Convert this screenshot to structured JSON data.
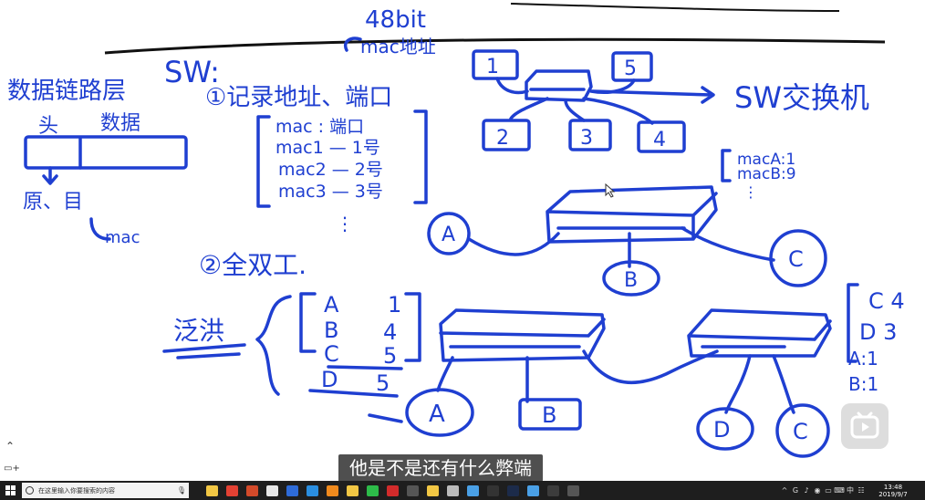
{
  "subtitle": "他是不是还有什么弊端",
  "whiteboard": {
    "bit_label": "48bit",
    "mac_addr_label": "mac地址",
    "sw_label": "SW:",
    "item1": "①记录地址、端口",
    "data_link": "数据链路层",
    "head": "头",
    "data": "数据",
    "src_dst": "原、目",
    "mac_note": "mac",
    "table_header": "mac : 端口",
    "table_rows": [
      "mac1 — 1号",
      "mac2 — 2号",
      "mac3 — 3号"
    ],
    "table_more": "⋮",
    "item2": "②全双工.",
    "flood": "泛洪",
    "list2": [
      [
        "A",
        "1"
      ],
      [
        "B",
        "4"
      ],
      [
        "C",
        "5"
      ],
      [
        "D",
        "5"
      ]
    ],
    "port_boxes": [
      "1",
      "5",
      "2",
      "3",
      "4"
    ],
    "sw_switch": "SW交换机",
    "right_list": [
      "macA:1",
      "macB:9",
      "⋮"
    ],
    "hosts_top": [
      "A",
      "B",
      "C"
    ],
    "hosts_bottom": [
      "A",
      "B",
      "D",
      "C"
    ],
    "right_list2": [
      "C 4",
      "D 3",
      "A:1",
      "B:1"
    ]
  },
  "taskbar": {
    "search_placeholder": "在这里输入你要搜索的内容",
    "time": "13:48",
    "date": "2019/9/7",
    "apps": [
      {
        "name": "file-explorer-icon",
        "color": "#f2c744"
      },
      {
        "name": "chrome-icon",
        "color": "#e34133"
      },
      {
        "name": "calculator-icon",
        "color": "#d34a2a"
      },
      {
        "name": "browser-icon",
        "color": "#e7e7e7"
      },
      {
        "name": "wps-icon",
        "color": "#2e6bd8"
      },
      {
        "name": "vscode-icon",
        "color": "#2a8ee0"
      },
      {
        "name": "xampp-icon",
        "color": "#f08a1d"
      },
      {
        "name": "folder-icon",
        "color": "#f2c744"
      },
      {
        "name": "wechat-icon",
        "color": "#2dbb49"
      },
      {
        "name": "player-icon",
        "color": "#d22b2b"
      },
      {
        "name": "pen-icon",
        "color": "#555555"
      },
      {
        "name": "explorer-icon",
        "color": "#f2c744"
      },
      {
        "name": "settings-icon",
        "color": "#bbbbbb"
      },
      {
        "name": "monitor-icon",
        "color": "#4aa0e6"
      },
      {
        "name": "terminal-icon",
        "color": "#333333"
      },
      {
        "name": "photoshop-icon",
        "color": "#1c2b4a"
      },
      {
        "name": "image-icon",
        "color": "#4aa0e6"
      },
      {
        "name": "tool-icon",
        "color": "#3c3c3c"
      },
      {
        "name": "camera-icon",
        "color": "#555555"
      }
    ],
    "tray": [
      "^",
      "G",
      "♪",
      "◉",
      "▭",
      "⌨",
      "中",
      "☷"
    ]
  },
  "colors": {
    "ink": "#1f3fd1",
    "taskbar": "#1e1e1e"
  }
}
